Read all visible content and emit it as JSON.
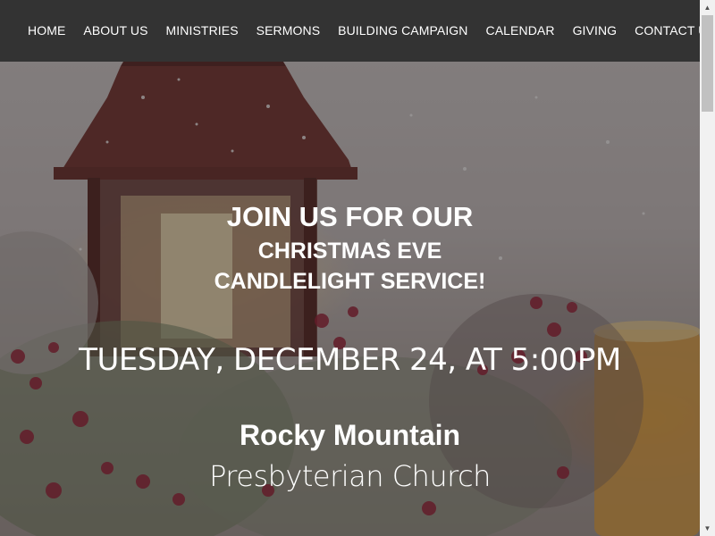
{
  "nav": {
    "items": [
      {
        "label": "HOME"
      },
      {
        "label": "ABOUT US"
      },
      {
        "label": "MINISTRIES"
      },
      {
        "label": "SERMONS"
      },
      {
        "label": "BUILDING CAMPAIGN"
      },
      {
        "label": "CALENDAR"
      },
      {
        "label": "GIVING"
      },
      {
        "label": "CONTACT US"
      }
    ]
  },
  "hero": {
    "line1": "JOIN US FOR OUR",
    "line2": "CHRISTMAS EVE",
    "line3": "CANDLELIGHT SERVICE!",
    "date": "TUESDAY, DECEMBER 24, AT 5:00PM",
    "church_name_1": "Rocky Mountain",
    "church_name_2": "Presbyterian Church"
  },
  "colors": {
    "navbar_bg": "#333333",
    "nav_text": "#ffffff",
    "hero_text": "#ffffff"
  },
  "scrollbar": {
    "up_icon": "arrow-up-icon",
    "down_icon": "arrow-down-icon"
  }
}
